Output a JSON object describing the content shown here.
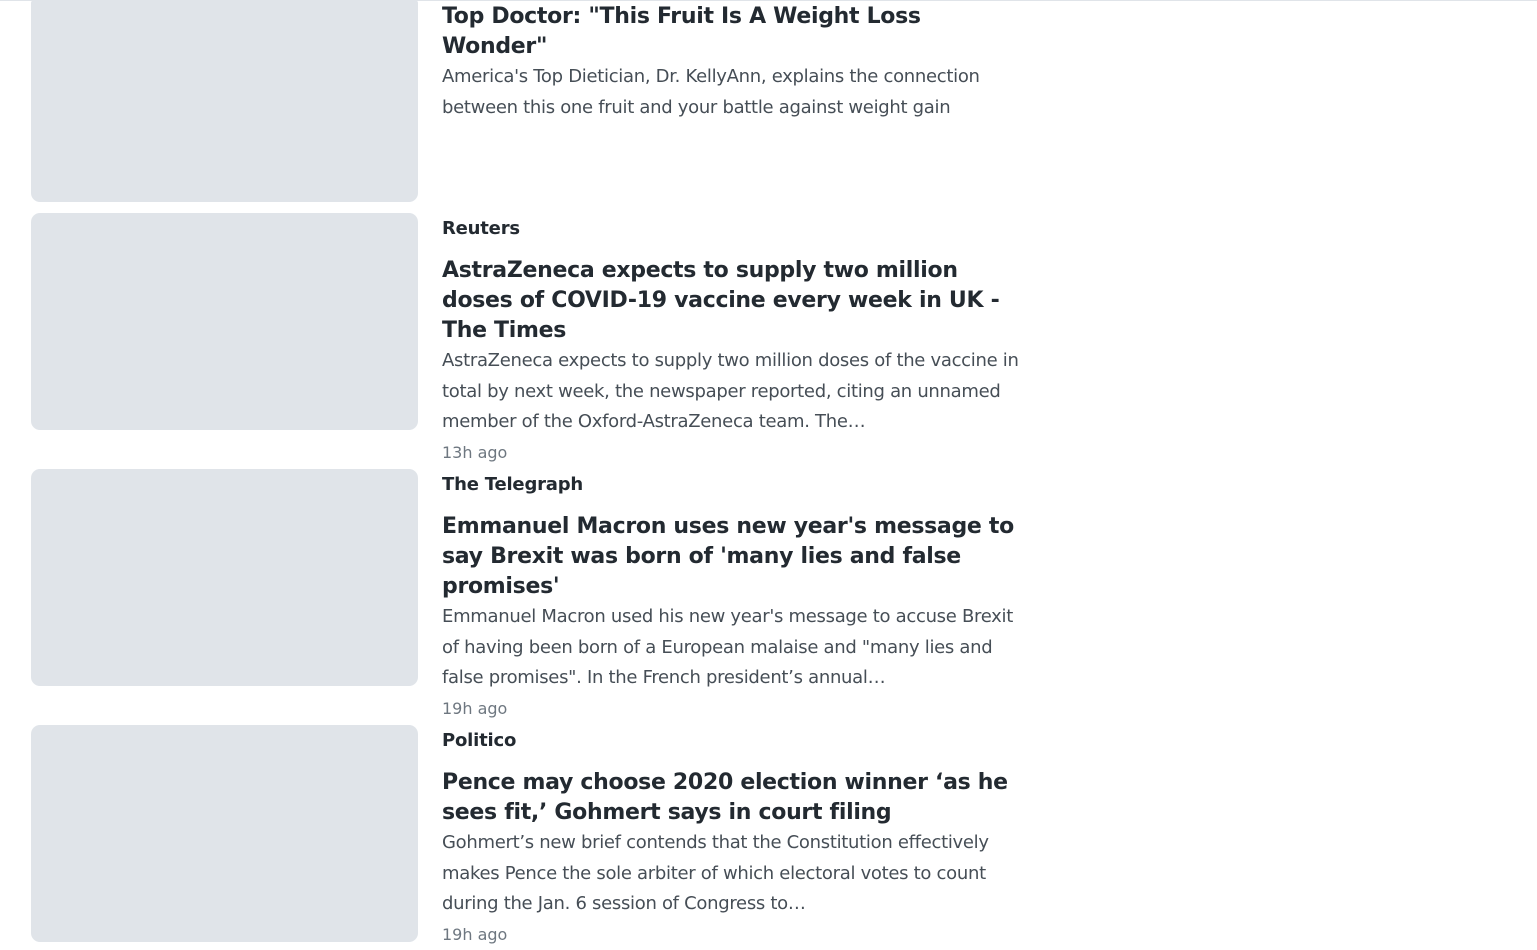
{
  "stories": [
    {
      "provider": "",
      "title": "Top Doctor: \"This Fruit Is A Weight Loss Wonder\"",
      "summary": "America's Top Dietician, Dr. KellyAnn, explains the connection between this one fruit and your battle against weight gain",
      "time": ""
    },
    {
      "provider": "Reuters",
      "title": "AstraZeneca expects to supply two million doses of COVID-19 vaccine every week in UK -The Times",
      "summary": "AstraZeneca expects to supply two million doses of the vaccine in total by next week, the newspaper reported, citing an unnamed member of the Oxford-AstraZeneca team. The…",
      "time": "13h ago"
    },
    {
      "provider": "The Telegraph",
      "title": "Emmanuel Macron uses new year's message to say Brexit was born of 'many lies and false promises'",
      "summary": "Emmanuel Macron used his new year's message to accuse Brexit of having been born of a European malaise and \"many lies and false promises\". In the French president’s annual…",
      "time": "19h ago"
    },
    {
      "provider": "Politico",
      "title": "Pence may choose 2020 election winner ‘as he sees fit,’ Gohmert says in court filing",
      "summary": "Gohmert’s new brief contends that the Constitution effectively makes Pence the sole arbiter of which electoral votes to count during the Jan. 6 session of Congress to…",
      "time": "19h ago"
    }
  ]
}
